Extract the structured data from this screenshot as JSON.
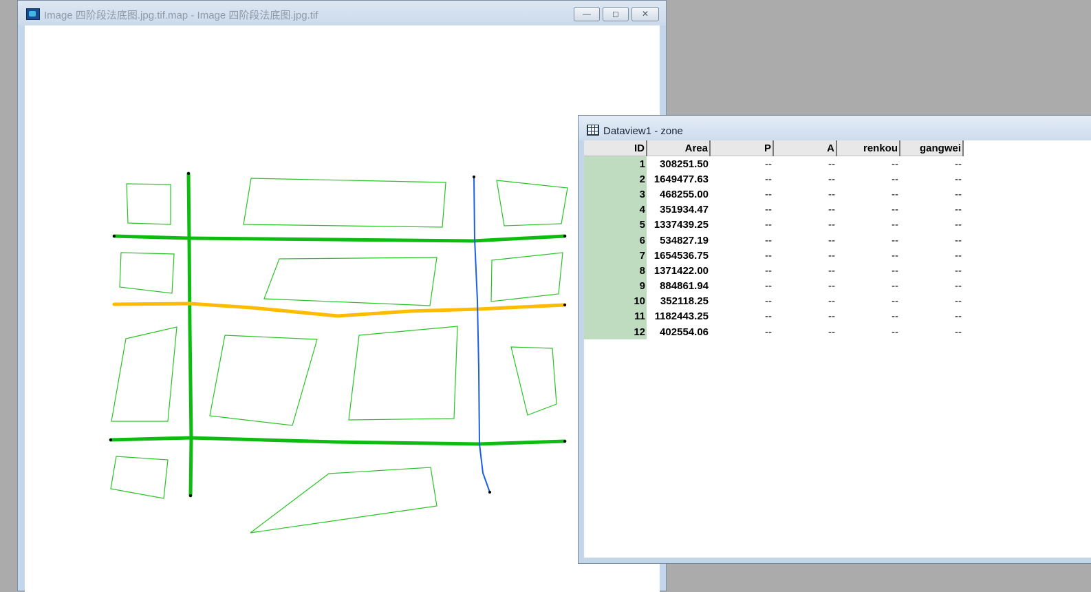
{
  "map_window": {
    "title": "Image 四阶段法底图.jpg.tif.map - Image 四阶段法底图.jpg.tif",
    "buttons": {
      "minimize": "—",
      "maximize": "◻",
      "close": "✕"
    },
    "icon": "map-app-icon",
    "colors": {
      "zone_outline": "#27c424",
      "main_road": "#0ebb11",
      "arterial_road": "#ffbb00",
      "river_line": "#1a5fe6"
    }
  },
  "data_window": {
    "title": "Dataview1 - zone",
    "icon": "table-icon",
    "columns": [
      "ID",
      "Area",
      "P",
      "A",
      "renkou",
      "gangwei"
    ],
    "rows": [
      {
        "id": "1",
        "area": "308251.50",
        "p": "--",
        "a": "--",
        "renkou": "--",
        "gangwei": "--"
      },
      {
        "id": "2",
        "area": "1649477.63",
        "p": "--",
        "a": "--",
        "renkou": "--",
        "gangwei": "--"
      },
      {
        "id": "3",
        "area": "468255.00",
        "p": "--",
        "a": "--",
        "renkou": "--",
        "gangwei": "--"
      },
      {
        "id": "4",
        "area": "351934.47",
        "p": "--",
        "a": "--",
        "renkou": "--",
        "gangwei": "--"
      },
      {
        "id": "5",
        "area": "1337439.25",
        "p": "--",
        "a": "--",
        "renkou": "--",
        "gangwei": "--"
      },
      {
        "id": "6",
        "area": "534827.19",
        "p": "--",
        "a": "--",
        "renkou": "--",
        "gangwei": "--"
      },
      {
        "id": "7",
        "area": "1654536.75",
        "p": "--",
        "a": "--",
        "renkou": "--",
        "gangwei": "--"
      },
      {
        "id": "8",
        "area": "1371422.00",
        "p": "--",
        "a": "--",
        "renkou": "--",
        "gangwei": "--"
      },
      {
        "id": "9",
        "area": "884861.94",
        "p": "--",
        "a": "--",
        "renkou": "--",
        "gangwei": "--"
      },
      {
        "id": "10",
        "area": "352118.25",
        "p": "--",
        "a": "--",
        "renkou": "--",
        "gangwei": "--"
      },
      {
        "id": "11",
        "area": "1182443.25",
        "p": "--",
        "a": "--",
        "renkou": "--",
        "gangwei": "--"
      },
      {
        "id": "12",
        "area": "402554.06",
        "p": "--",
        "a": "--",
        "renkou": "--",
        "gangwei": "--"
      }
    ]
  }
}
